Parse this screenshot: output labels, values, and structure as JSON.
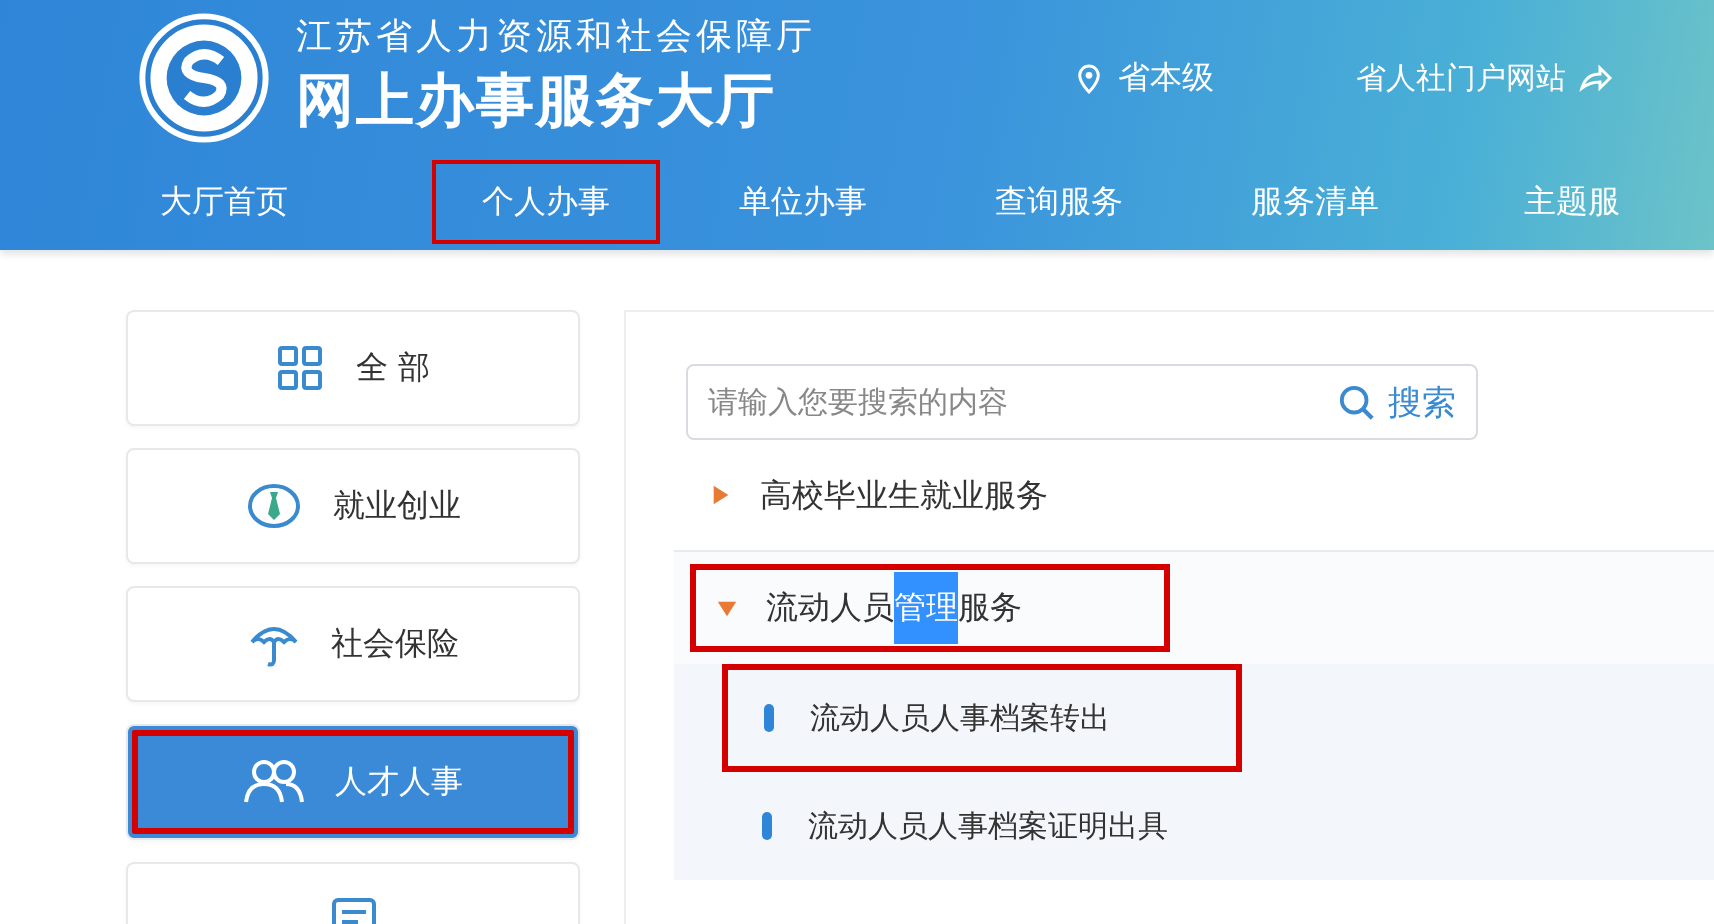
{
  "header": {
    "subtitle": "江苏省人力资源和社会保障厅",
    "title": "网上办事服务大厅",
    "location": "省本级",
    "portal_link": "省人社门户网站"
  },
  "nav": [
    {
      "label": "大厅首页",
      "highlighted": false
    },
    {
      "label": "个人办事",
      "highlighted": true
    },
    {
      "label": "单位办事",
      "highlighted": false
    },
    {
      "label": "查询服务",
      "highlighted": false
    },
    {
      "label": "服务清单",
      "highlighted": false
    },
    {
      "label": "主题服",
      "highlighted": false
    }
  ],
  "sidebar": {
    "items": [
      {
        "label": "全 部",
        "kind": "grid",
        "selected": false,
        "highlighted": false
      },
      {
        "label": "就业创业",
        "kind": "tie",
        "selected": false,
        "highlighted": false
      },
      {
        "label": "社会保险",
        "kind": "umbrella",
        "selected": false,
        "highlighted": false
      },
      {
        "label": "人才人事",
        "kind": "people",
        "selected": true,
        "highlighted": true
      },
      {
        "kind": "document",
        "selected": false,
        "highlighted": false
      }
    ]
  },
  "search": {
    "placeholder": "请输入您要搜索的内容",
    "button": "搜索"
  },
  "tree": [
    {
      "segments": [
        {
          "text": "高校毕业生就业服务",
          "selected": false
        }
      ],
      "expanded": false,
      "highlighted": false
    },
    {
      "segments": [
        {
          "text": "流动人员",
          "selected": false
        },
        {
          "text": "管理",
          "selected": true
        },
        {
          "text": "服务",
          "selected": false
        }
      ],
      "expanded": true,
      "highlighted": true,
      "children": [
        {
          "label": "流动人员人事档案转出",
          "highlighted": true
        },
        {
          "label": "流动人员人事档案证明出具",
          "highlighted": false
        }
      ]
    }
  ]
}
